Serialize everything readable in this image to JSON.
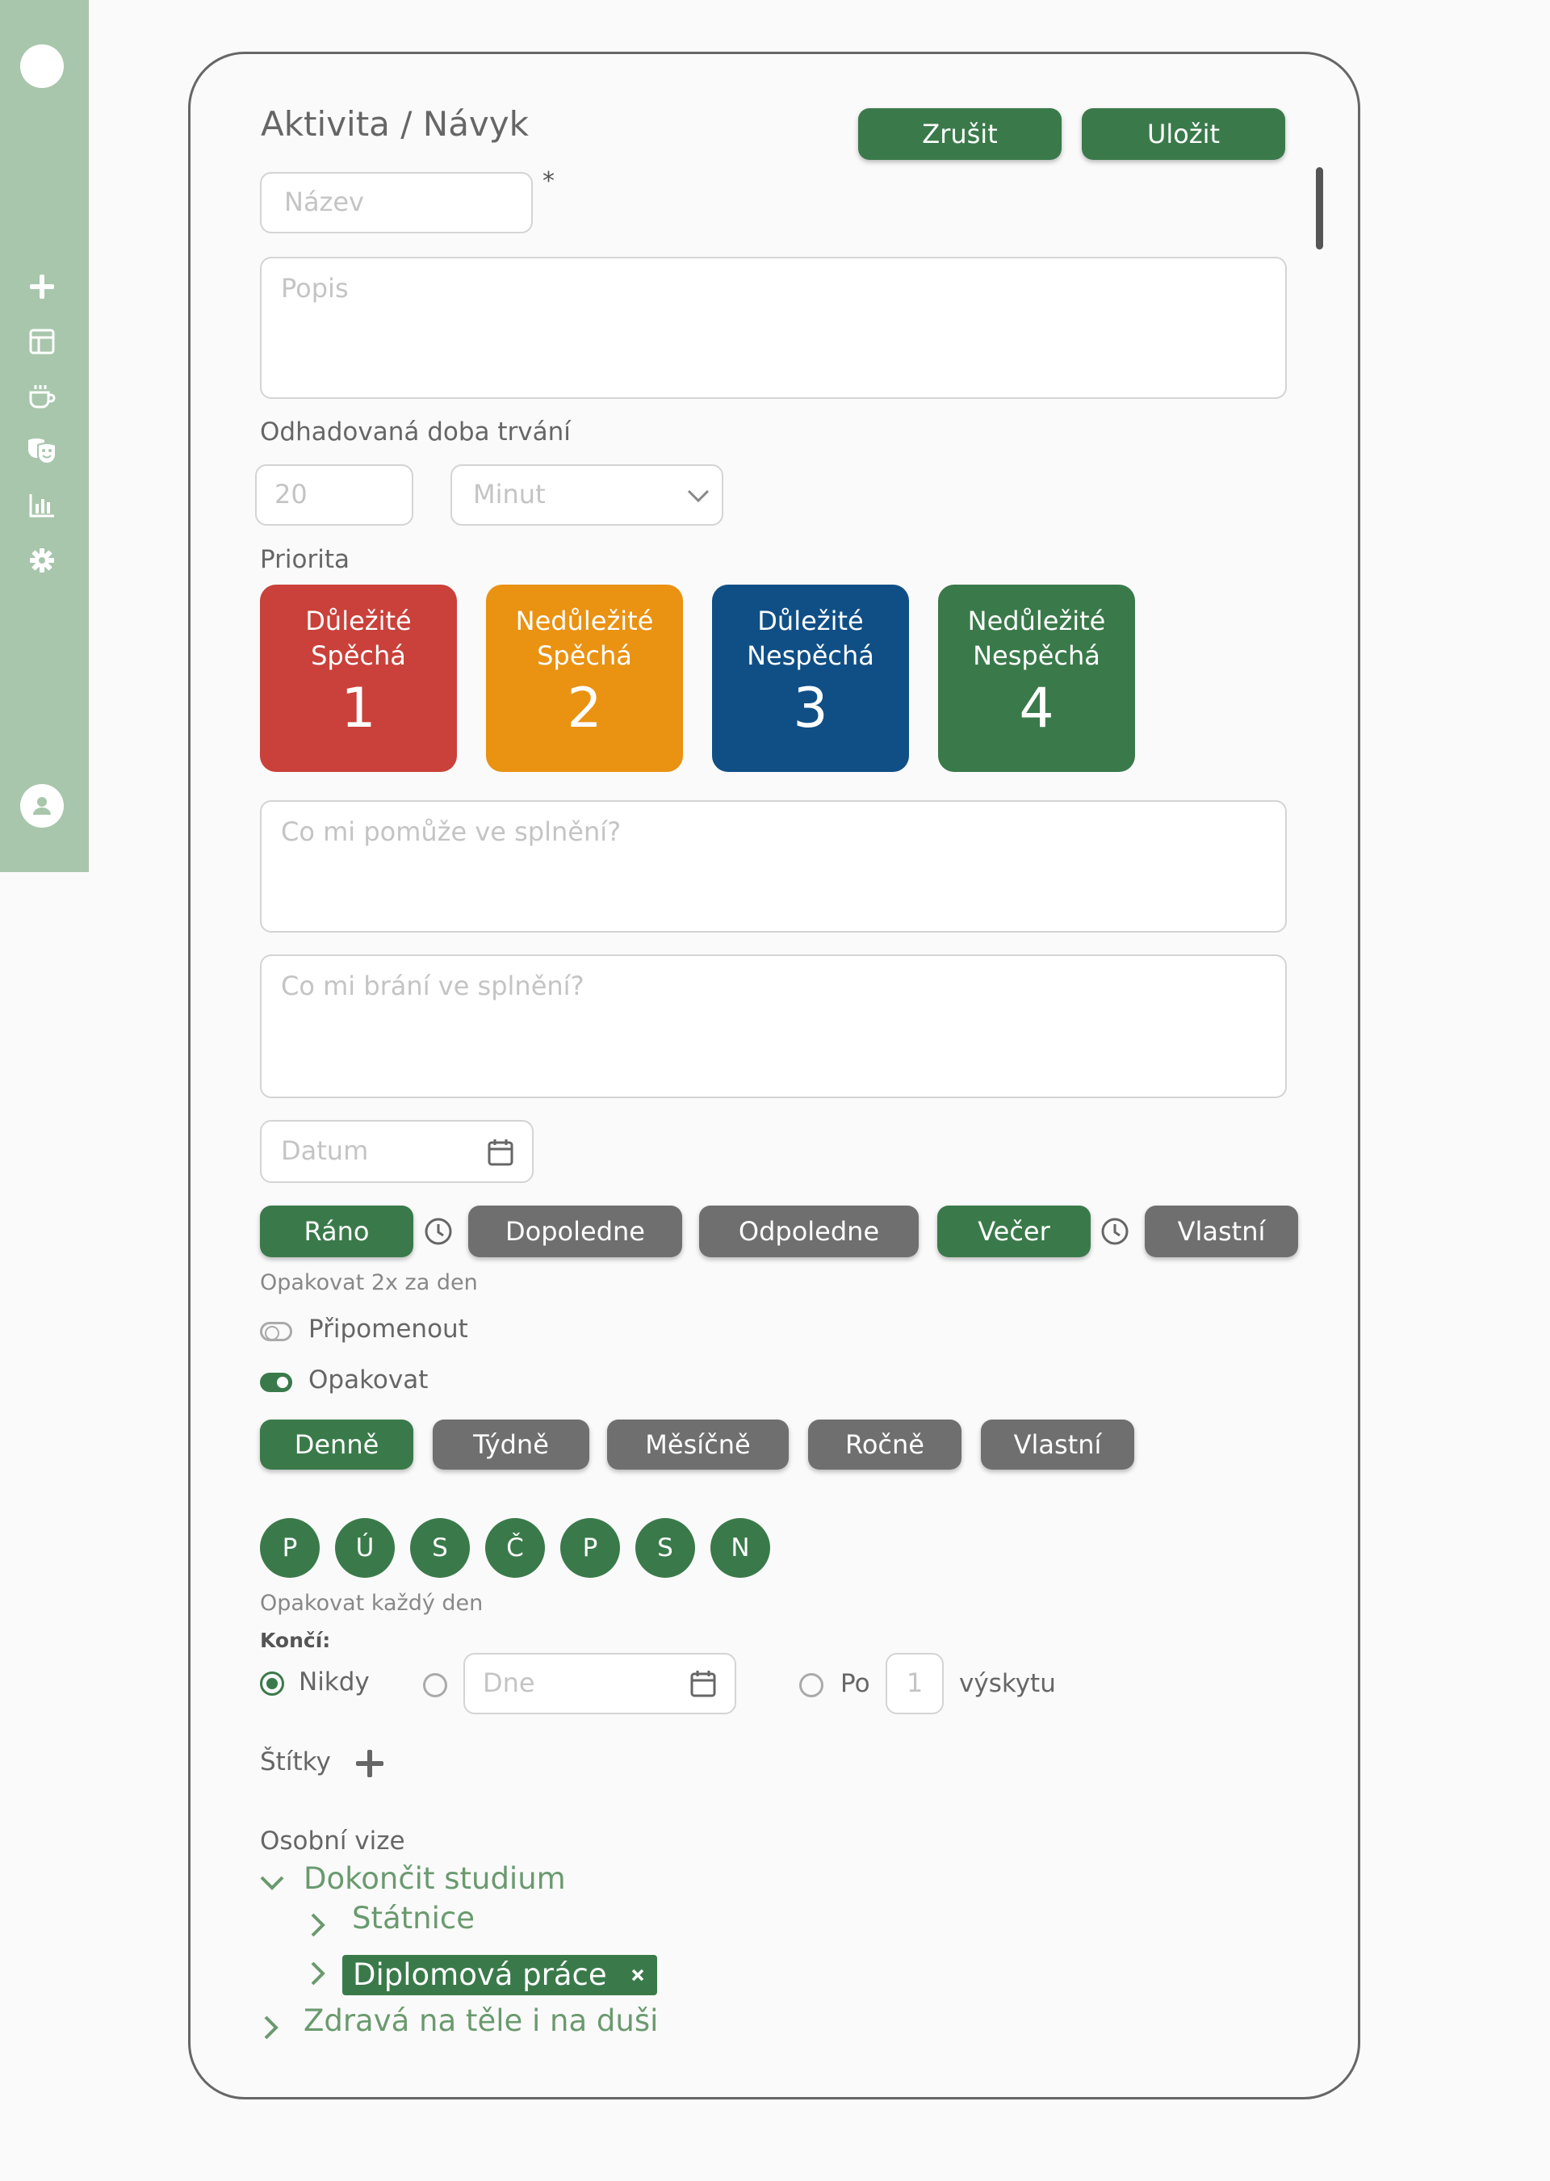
{
  "form": {
    "title": "Aktivita / Návyk",
    "cancel_label": "Zrušit",
    "save_label": "Uložit",
    "name_placeholder": "Název",
    "required_mark": "*",
    "description_placeholder": "Popis",
    "duration_label": "Odhadovaná doba trvání",
    "duration_value": "20",
    "duration_unit": "Minut",
    "priority_label": "Priorita",
    "priorities": [
      {
        "line1": "Důležité",
        "line2": "Spěchá",
        "number": "1",
        "color": "#c9413a"
      },
      {
        "line1": "Nedůležité",
        "line2": "Spěchá",
        "number": "2",
        "color": "#ea9212"
      },
      {
        "line1": "Důležité",
        "line2": "Nespěchá",
        "number": "3",
        "color": "#104f86"
      },
      {
        "line1": "Nedůležité",
        "line2": "Nespěchá",
        "number": "4",
        "color": "#3a7a4a"
      }
    ],
    "help_placeholder": "Co mi pomůže ve splnění?",
    "block_placeholder": "Co mi brání ve splnění?",
    "date_placeholder": "Datum",
    "times": [
      {
        "label": "Ráno",
        "active": true
      },
      {
        "label": "Dopoledne",
        "active": false
      },
      {
        "label": "Odpoledne",
        "active": false
      },
      {
        "label": "Večer",
        "active": true
      },
      {
        "label": "Vlastní",
        "active": false
      }
    ],
    "times_note": "Opakovat 2x za den",
    "remind_label": "Připomenout",
    "repeat_label": "Opakovat",
    "frequencies": [
      {
        "label": "Denně",
        "active": true
      },
      {
        "label": "Týdně",
        "active": false
      },
      {
        "label": "Měsíčně",
        "active": false
      },
      {
        "label": "Ročně",
        "active": false
      },
      {
        "label": "Vlastní",
        "active": false
      }
    ],
    "weekdays": [
      "P",
      "Ú",
      "S",
      "Č",
      "P",
      "S",
      "N"
    ],
    "repeat_note": "Opakovat každý den",
    "ends_label": "Končí:",
    "ends_never": "Nikdy",
    "ends_date_placeholder": "Dne",
    "ends_after": "Po",
    "ends_count": "1",
    "ends_occurrences": "výskytu",
    "tags_label": "Štítky",
    "vision_label": "Osobní vize",
    "vision_tree": {
      "root1": "Dokončit studium",
      "child1": "Státnice",
      "child2": "Diplomová práce",
      "root2": "Zdravá na těle i na duši"
    }
  },
  "colors": {
    "accent": "#3a7a4a",
    "sidebar": "#a8c6ab",
    "inactive": "#6f6f6f"
  }
}
